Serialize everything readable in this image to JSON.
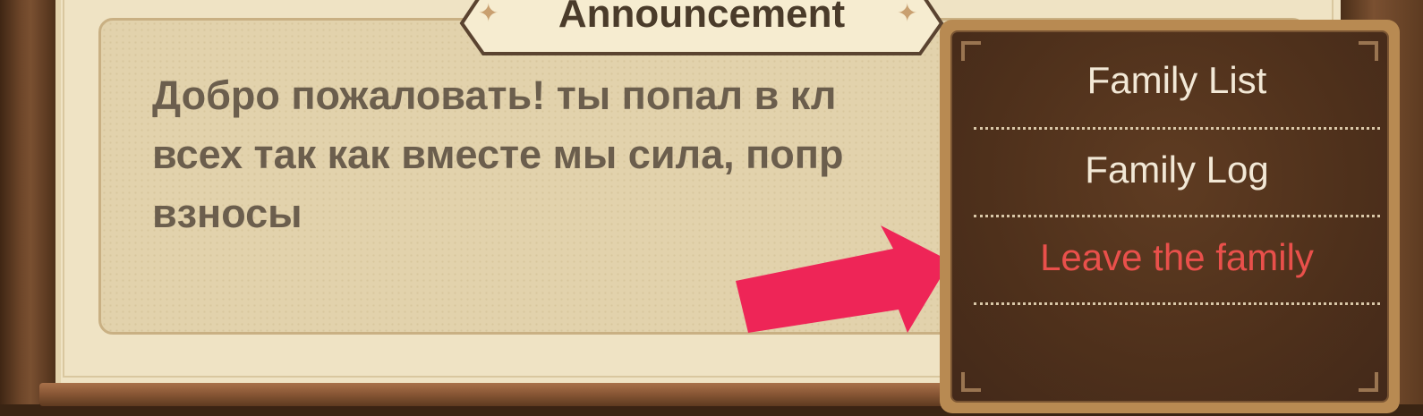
{
  "announcement": {
    "title": "Announcement",
    "text": "Добро пожаловать! ты попал в кл\nвсех так как вместе мы сила, попр\nвзносы"
  },
  "menu": {
    "items": [
      {
        "label": "Family List"
      },
      {
        "label": "Family Log"
      },
      {
        "label": "Leave the family"
      }
    ]
  },
  "colors": {
    "danger": "#e9504b",
    "arrow": "#ee2557",
    "panel": "#efe3c4",
    "menu_bg": "#4e301b"
  },
  "icons": [
    "sparkle-icon",
    "arrow-icon"
  ]
}
